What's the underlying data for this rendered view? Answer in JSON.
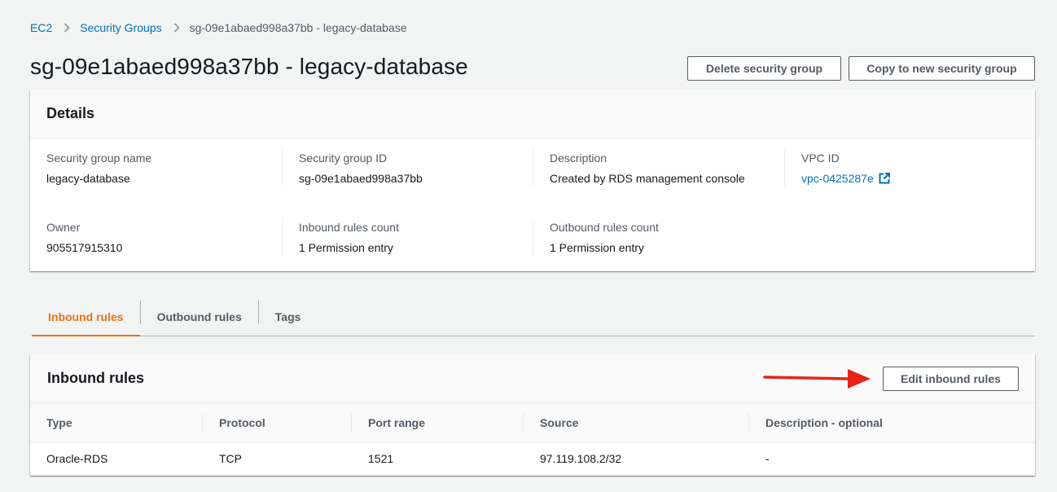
{
  "breadcrumb": {
    "items": [
      "EC2",
      "Security Groups"
    ],
    "current": "sg-09e1abaed998a37bb - legacy-database"
  },
  "page_title": "sg-09e1abaed998a37bb - legacy-database",
  "actions": {
    "delete": "Delete security group",
    "copy": "Copy to new security group"
  },
  "details": {
    "title": "Details",
    "fields": {
      "sg_name": {
        "label": "Security group name",
        "value": "legacy-database"
      },
      "sg_id": {
        "label": "Security group ID",
        "value": "sg-09e1abaed998a37bb"
      },
      "description": {
        "label": "Description",
        "value": "Created by RDS management console"
      },
      "vpc_id": {
        "label": "VPC ID",
        "value": "vpc-0425287e"
      },
      "owner": {
        "label": "Owner",
        "value": "905517915310"
      },
      "inbound_count": {
        "label": "Inbound rules count",
        "value": "1 Permission entry"
      },
      "outbound_count": {
        "label": "Outbound rules count",
        "value": "1 Permission entry"
      }
    }
  },
  "tabs": [
    "Inbound rules",
    "Outbound rules",
    "Tags"
  ],
  "inbound": {
    "title": "Inbound rules",
    "edit_button": "Edit inbound rules",
    "columns": [
      "Type",
      "Protocol",
      "Port range",
      "Source",
      "Description - optional"
    ],
    "rows": [
      [
        "Oracle-RDS",
        "TCP",
        "1521",
        "97.119.108.2/32",
        "-"
      ]
    ]
  },
  "colors": {
    "link": "#0073bb",
    "active_tab": "#ec7211",
    "annotation_arrow": "#e8231b"
  }
}
